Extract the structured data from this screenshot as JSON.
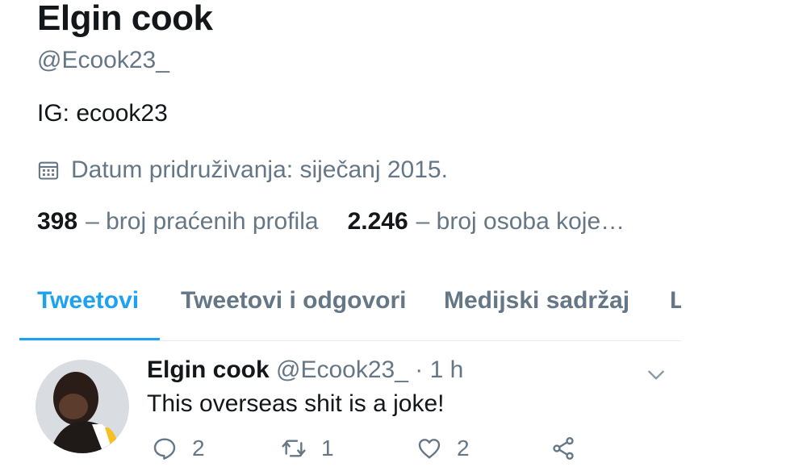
{
  "profile": {
    "name": "Elgin cook",
    "handle": "@Ecook23_",
    "bio": "IG: ecook23",
    "join_date": "Datum pridruživanja: siječanj 2015.",
    "following_count": "398",
    "following_label": "– broj praćenih profila",
    "followers_count": "2.246",
    "followers_label": "– broj osoba koje…"
  },
  "tabs": [
    {
      "label": "Tweetovi",
      "active": true
    },
    {
      "label": "Tweetovi i odgovori",
      "active": false
    },
    {
      "label": "Medijski sadržaj",
      "active": false
    },
    {
      "label": "L",
      "active": false
    }
  ],
  "tweet": {
    "author_name": "Elgin cook",
    "author_handle": "@Ecook23_",
    "separator": "·",
    "time": "1 h",
    "text": "This overseas shit is a joke!",
    "reply_count": "2",
    "retweet_count": "1",
    "like_count": "2"
  },
  "icons": {
    "calendar": "calendar-icon",
    "reply": "reply-icon",
    "retweet": "retweet-icon",
    "like": "heart-icon",
    "share": "share-icon",
    "caret": "chevron-down-icon"
  },
  "colors": {
    "accent": "#1da1f2",
    "text_primary": "#14171a",
    "text_secondary": "#657786",
    "divider": "#e6ecf0"
  }
}
